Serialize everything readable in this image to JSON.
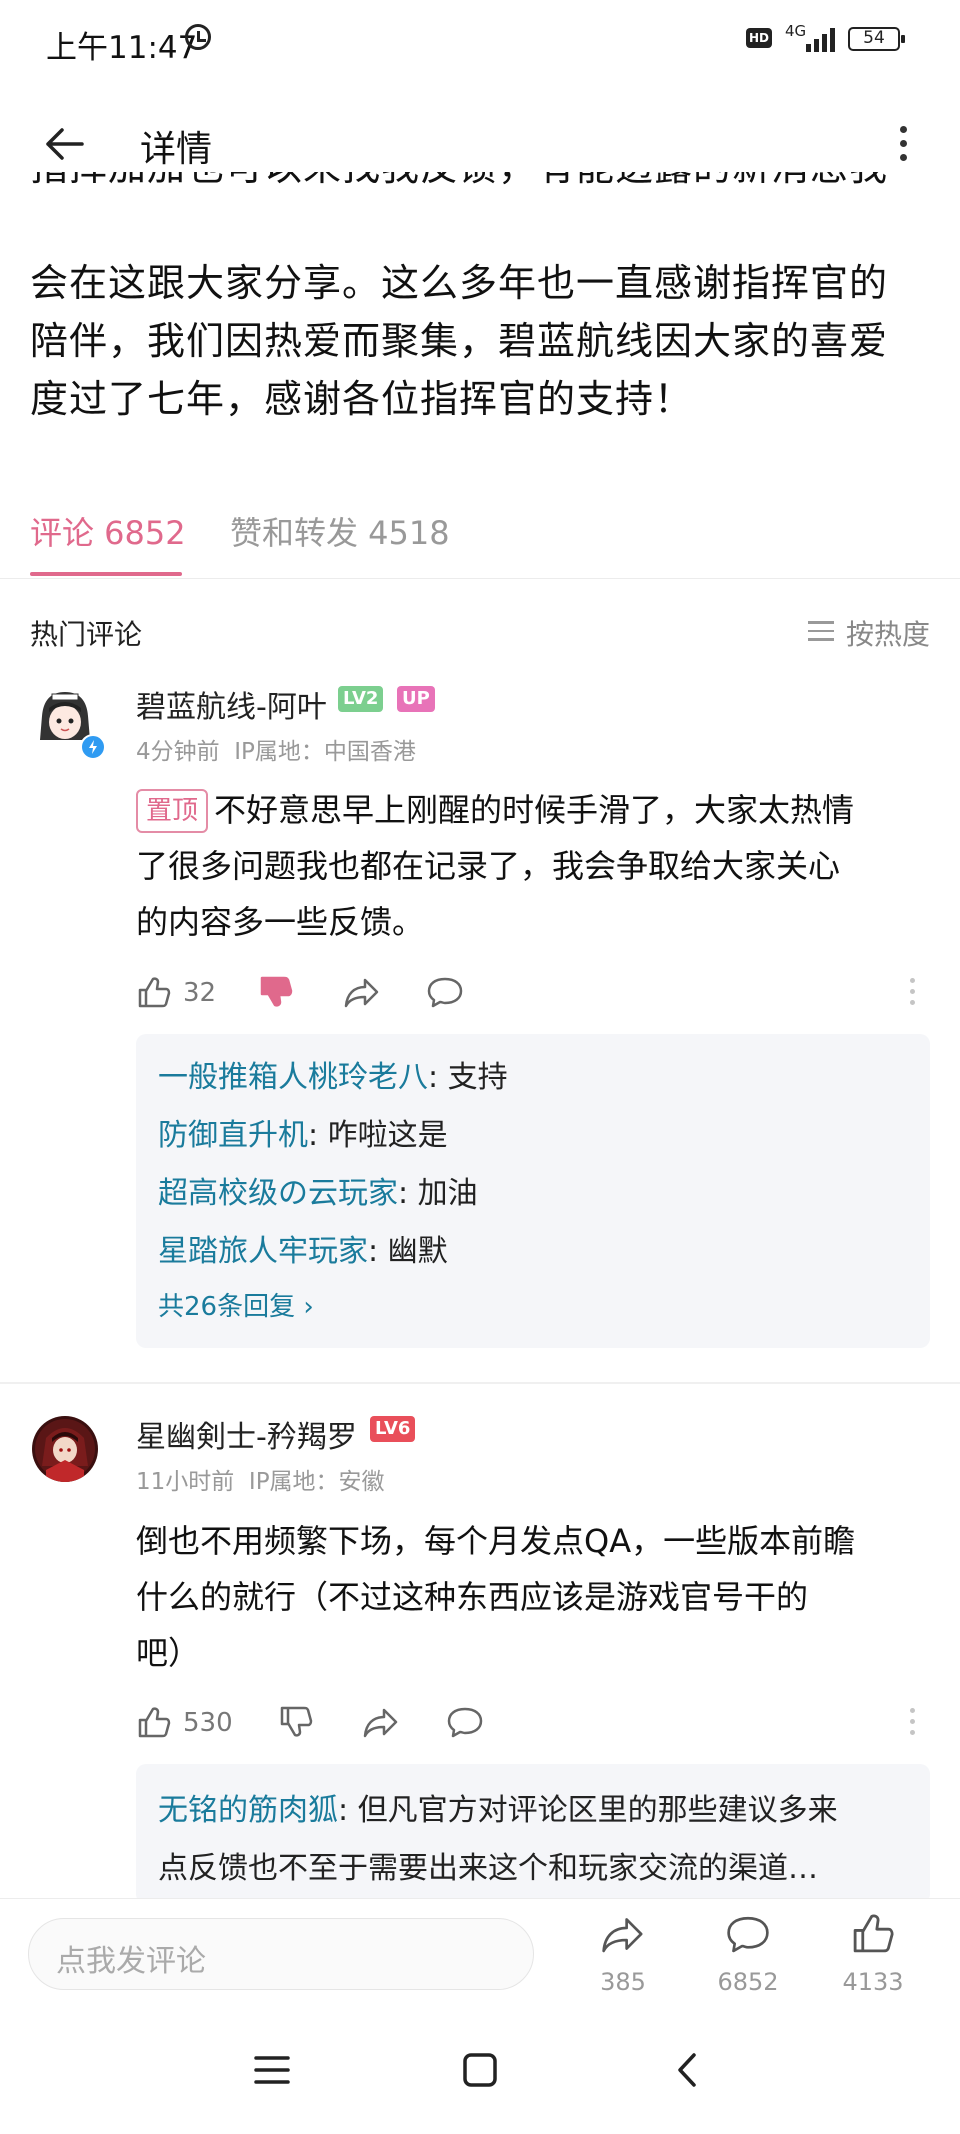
{
  "status_bar": {
    "time": "上午11:47",
    "network": "4G",
    "hd": "HD",
    "battery": "54"
  },
  "header": {
    "title": "详情"
  },
  "post": {
    "cut_line": "指挥加加也可以来找我反馈，有能透露的新消息我",
    "lines": [
      "会在这跟大家分享。这么多年也一直感谢指挥官的",
      "陪伴，我们因热爱而聚集，碧蓝航线因大家的喜爱",
      "度过了七年，感谢各位指挥官的支持！"
    ]
  },
  "tabs": {
    "comments": "评论 6852",
    "likes_reposts": "赞和转发 4518"
  },
  "comments_section": {
    "hot_label": "热门评论",
    "sort_label": "按热度"
  },
  "comments": [
    {
      "username": "碧蓝航线-阿叶",
      "badges": [
        "LV2",
        "UP"
      ],
      "time": "4分钟前",
      "ip": "IP属地：中国香港",
      "pin_label": "置顶",
      "text_line1": "不好意思早上刚醒的时候手滑了，大家太热情",
      "text_line2": "了很多问题我也都在记录了，我会争取给大家关心",
      "text_line3": "的内容多一些反馈。",
      "likes": "32",
      "replies": [
        {
          "name": "一般推箱人桃玲老八",
          "text": ": 支持"
        },
        {
          "name": "防御直升机",
          "text": ": 咋啦这是"
        },
        {
          "name": "超高校级の云玩家",
          "text": ": 加油"
        },
        {
          "name": "星踏旅人牢玩家",
          "text": ": 幽默"
        }
      ],
      "reply_total": "共26条回复"
    },
    {
      "username": "星幽剣士-矜羯罗",
      "badges": [
        "LV6"
      ],
      "time": "11小时前",
      "ip": "IP属地：安徽",
      "text_line1": "倒也不用频繁下场，每个月发点QA，一些版本前瞻",
      "text_line2": "什么的就行（不过这种东西应该是游戏官号干的",
      "text_line3": "吧）",
      "likes": "530",
      "replies": [
        {
          "name": "无铭的筋肉狐",
          "text": ": 但凡官方对评论区里的那些建议多来",
          "text2": "点反馈也不至于需要出来这个和玩家交流的渠道…"
        }
      ]
    }
  ],
  "bottom_bar": {
    "input_placeholder": "点我发评论",
    "share_count": "385",
    "comment_count": "6852",
    "like_count": "4133"
  },
  "colors": {
    "accent": "#e0698c",
    "reply_name": "#1a7b9c",
    "lv2": "#7ccf8f",
    "up": "#e873b8",
    "lv6": "#e94f5a"
  }
}
